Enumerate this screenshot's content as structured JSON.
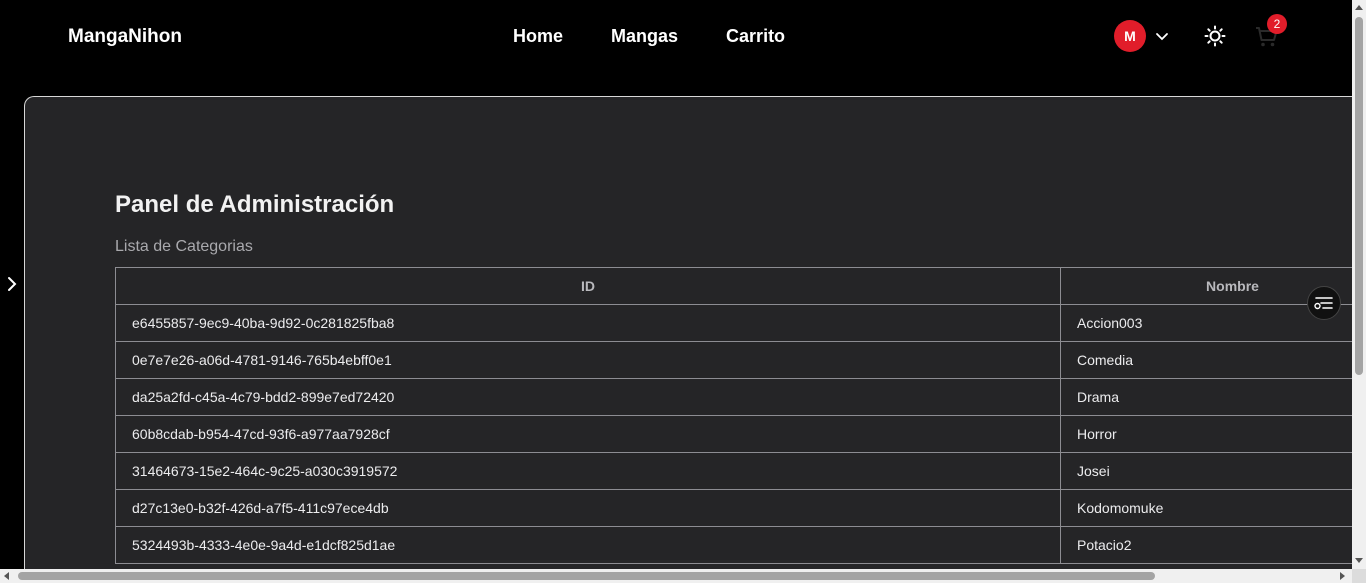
{
  "navbar": {
    "brand": "MangaNihon",
    "links": [
      "Home",
      "Mangas",
      "Carrito"
    ],
    "avatar_initial": "M",
    "cart_count": "2"
  },
  "main": {
    "title": "Panel de Administración",
    "subtitle": "Lista de Categorias",
    "table": {
      "headers": [
        "ID",
        "Nombre"
      ],
      "rows": [
        [
          "e6455857-9ec9-40ba-9d92-0c281825fba8",
          "Accion003"
        ],
        [
          "0e7e7e26-a06d-4781-9146-765b4ebff0e1",
          "Comedia"
        ],
        [
          "da25a2fd-c45a-4c79-bdd2-899e7ed72420",
          "Drama"
        ],
        [
          "60b8cdab-b954-47cd-93f6-a977aa7928cf",
          "Horror"
        ],
        [
          "31464673-15e2-464c-9c25-a030c3919572",
          "Josei"
        ],
        [
          "d27c13e0-b32f-426d-a7f5-411c97ece4db",
          "Kodomomuke"
        ],
        [
          "5324493b-4333-4e0e-9a4d-e1dcf825d1ae",
          "Potacio2"
        ]
      ]
    }
  },
  "colors": {
    "accent": "#e11d2a",
    "panel_bg": "#252527",
    "page_bg": "#000000"
  },
  "icons": [
    "chevron-down-icon",
    "sun-icon",
    "cart-icon",
    "chevron-right-icon",
    "filter-list-icon"
  ]
}
